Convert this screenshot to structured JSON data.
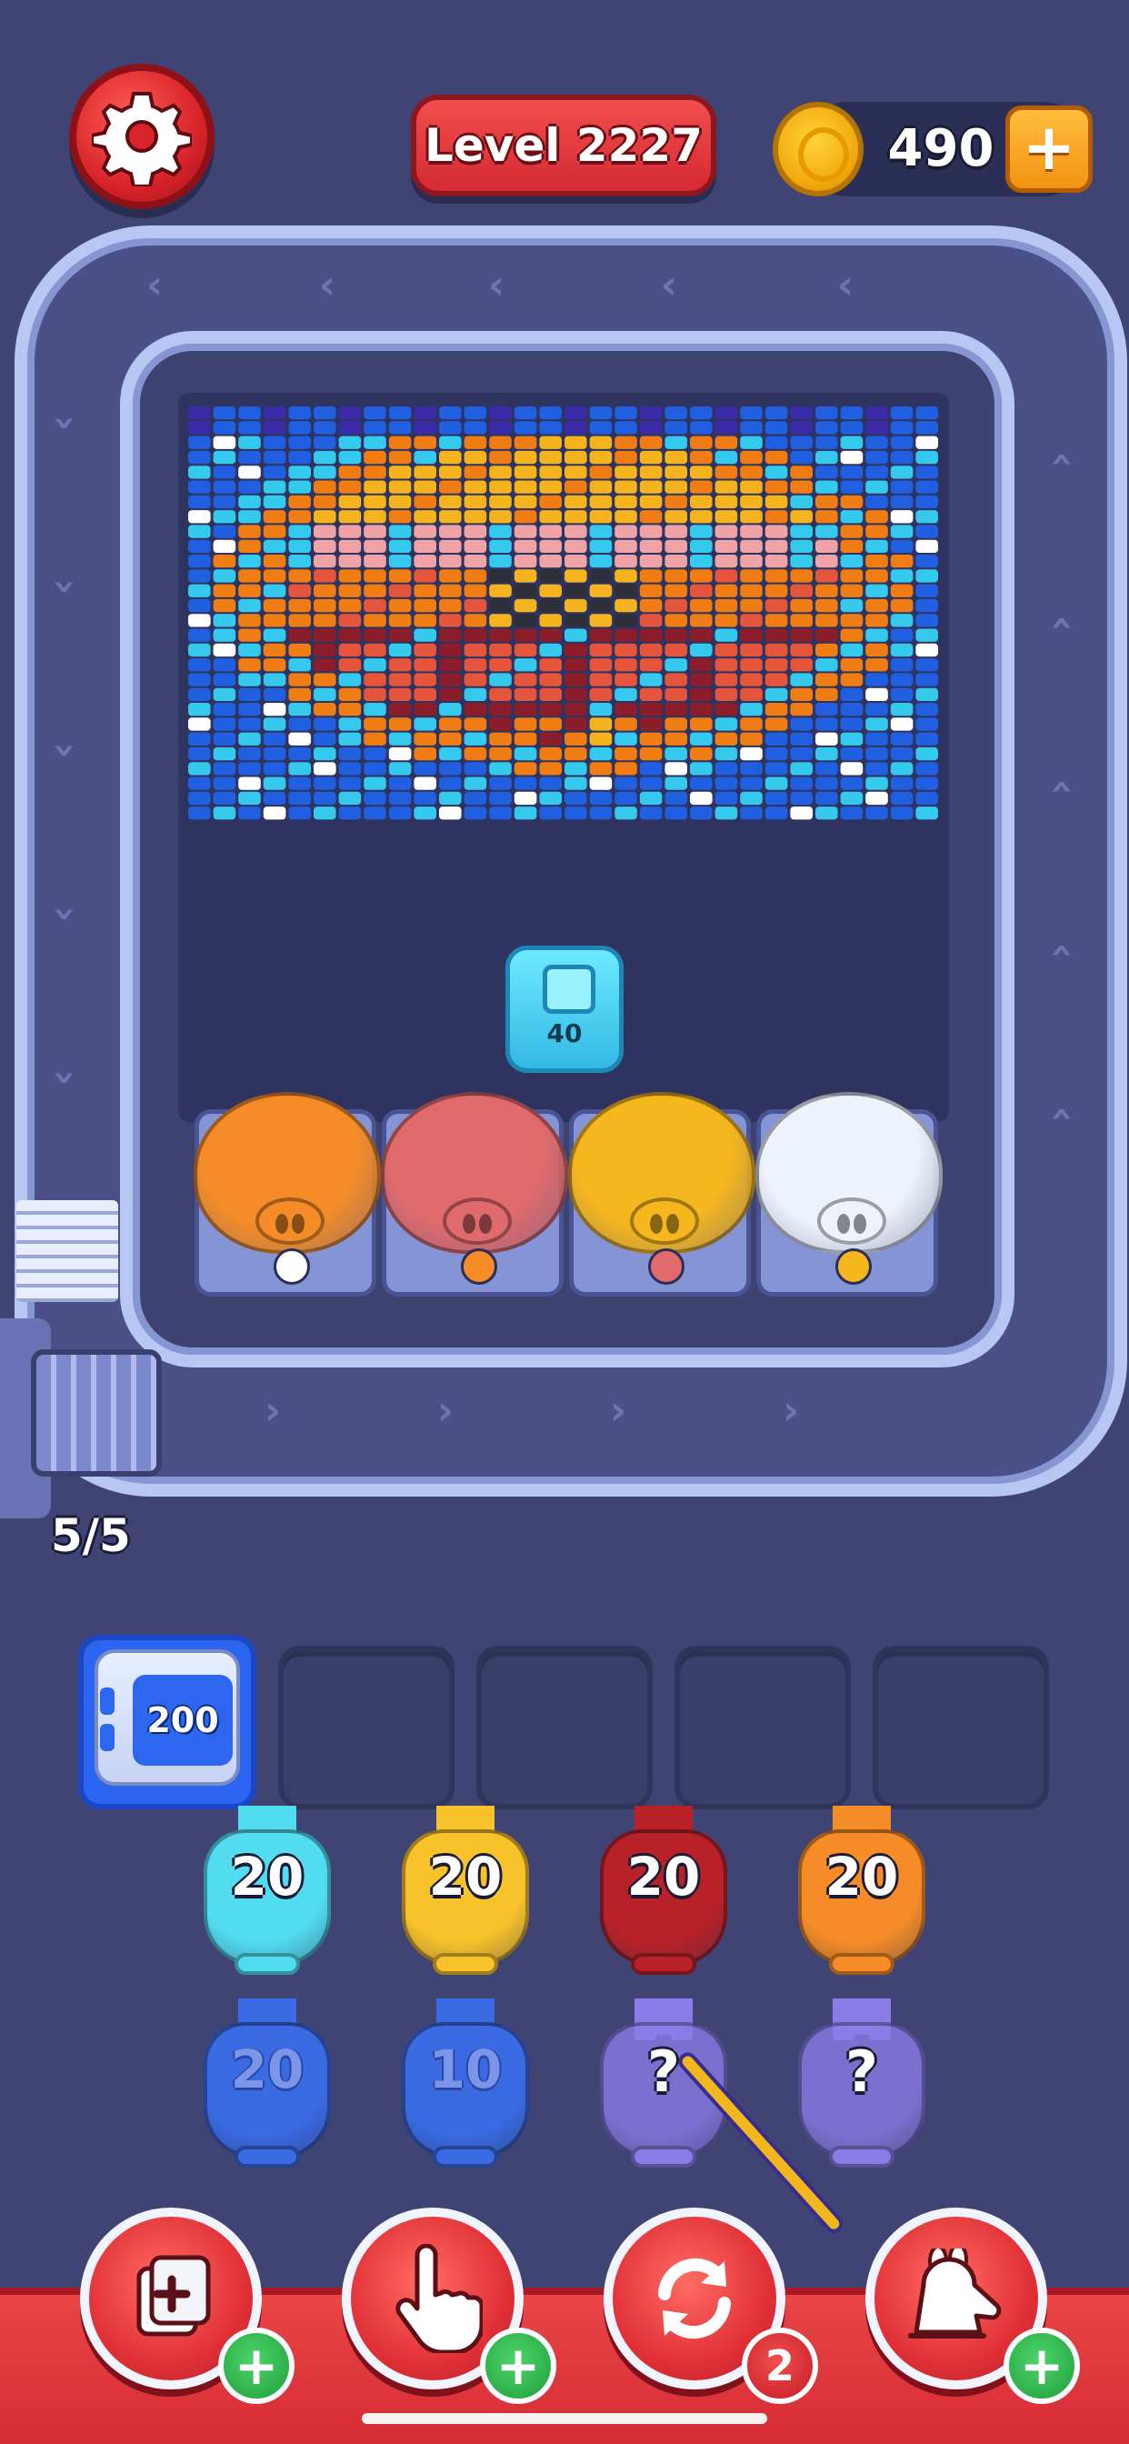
{
  "header": {
    "level_label": "Level 2227",
    "coins": "490",
    "coin_plus": "+",
    "settings_icon": "gear-icon"
  },
  "colors": {
    "background": "#3f4474",
    "track": "#4b5089",
    "accent_red": "#d62c35",
    "coin_gold": "#f2a90d",
    "pixel_palette": [
      "#35c9ee",
      "#1f5fe0",
      "#f5b31e",
      "#f07d14",
      "#e4553b",
      "#8b1e2a",
      "#3b2ba8",
      "#ffffff",
      "#2d2f3a",
      "#f0a3a6"
    ]
  },
  "conveyor": {
    "queue_count": "5/5"
  },
  "board": {
    "carrier_value": "40"
  },
  "pigs": [
    {
      "color": "#f58c27",
      "tag_color": "#ffffff"
    },
    {
      "color": "#e06a6c",
      "tag_color": "#f58c27"
    },
    {
      "color": "#f6b61d",
      "tag_color": "#e06a6c"
    },
    {
      "color": "#eef2fb",
      "tag_color": "#f6b61d"
    }
  ],
  "storage": {
    "active_value": "200",
    "slots_total": 5
  },
  "bunnies": {
    "row1": [
      {
        "value": "20",
        "color": "#52dcf0"
      },
      {
        "value": "20",
        "color": "#f7c22a"
      },
      {
        "value": "20",
        "color": "#b82128"
      },
      {
        "value": "20",
        "color": "#f58c27"
      }
    ],
    "row2": [
      {
        "value": "20",
        "color": "#3a6be3"
      },
      {
        "value": "10",
        "color": "#3a6be3"
      },
      {
        "value": "?",
        "color": "#8b7ce8"
      },
      {
        "value": "?",
        "color": "#8b7ce8"
      }
    ]
  },
  "toolbar": {
    "buttons": [
      {
        "icon": "add-slot-icon",
        "badge": "+"
      },
      {
        "icon": "tap-hand-icon",
        "badge": "+"
      },
      {
        "icon": "shuffle-icon",
        "badge": "2"
      },
      {
        "icon": "bunny-vacuum-icon",
        "badge": "+"
      }
    ]
  }
}
